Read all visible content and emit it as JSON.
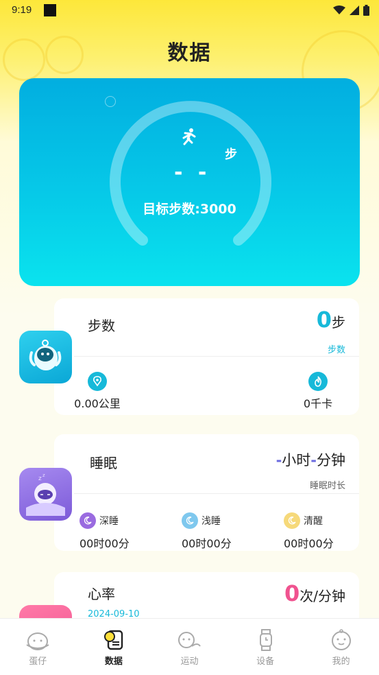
{
  "status_bar": {
    "time": "9:19"
  },
  "page": {
    "title": "数据"
  },
  "hero": {
    "step_unit": "步",
    "step_value": "- -",
    "goal_text": "目标步数:3000"
  },
  "steps_card": {
    "title": "步数",
    "value": "0",
    "value_unit": "步",
    "sub_label": "步数",
    "distance": "0.00公里",
    "calories": "0千卡"
  },
  "sleep_card": {
    "title": "睡眠",
    "hours_dash": "-",
    "hours_unit": "小时",
    "minutes_dash": "-",
    "minutes_unit": "分钟",
    "sub_label": "睡眠时长",
    "stats": [
      {
        "label": "深睡",
        "value": "00时00分",
        "color": "#9a6be0"
      },
      {
        "label": "浅睡",
        "value": "00时00分",
        "color": "#7fc8ee"
      },
      {
        "label": "清醒",
        "value": "00时00分",
        "color": "#f6d97a"
      }
    ]
  },
  "heart_card": {
    "title": "心率",
    "date": "2024-09-10",
    "value": "0",
    "value_unit": "次/分钟"
  },
  "bottom_nav": [
    {
      "label": "蛋仔",
      "icon": "egg-face-icon"
    },
    {
      "label": "数据",
      "icon": "data-sheet-icon"
    },
    {
      "label": "运动",
      "icon": "exercise-icon"
    },
    {
      "label": "设备",
      "icon": "watch-icon"
    },
    {
      "label": "我的",
      "icon": "profile-face-icon"
    }
  ],
  "colors": {
    "accent_cyan": "#17b9d9",
    "accent_pink": "#f0538f",
    "hero_gradient_top": "#02aee0",
    "hero_gradient_bottom": "#0ae3ee"
  }
}
